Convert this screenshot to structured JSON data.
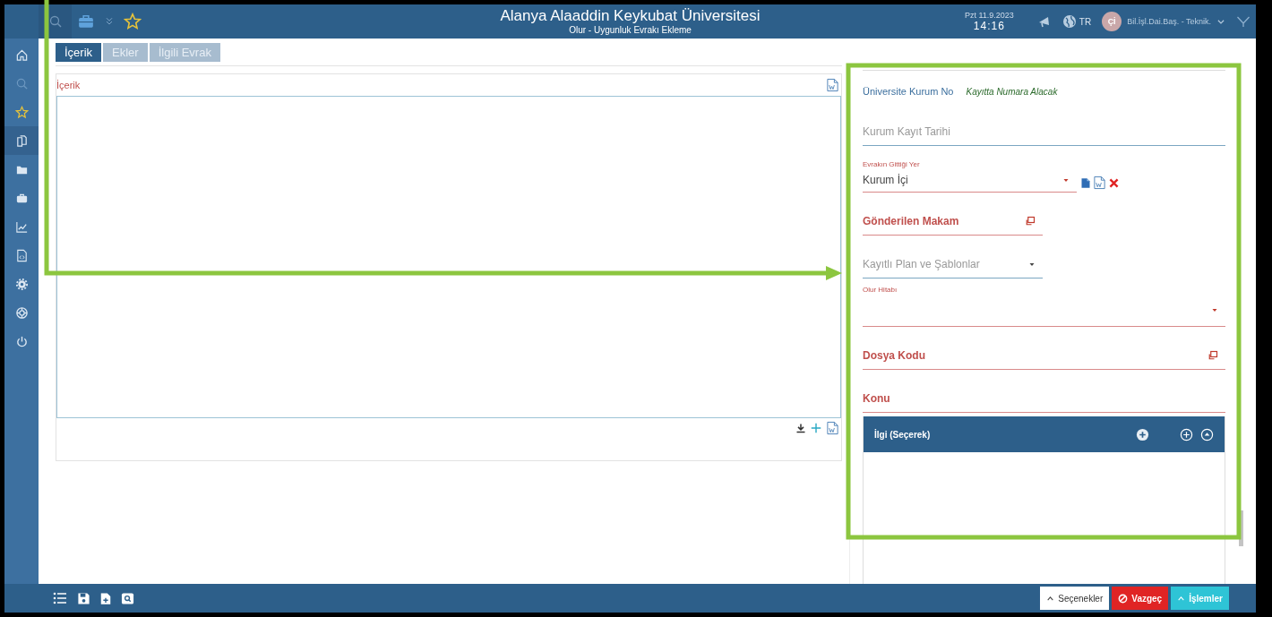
{
  "header": {
    "title": "Alanya Alaaddin Keykubat Üniversitesi",
    "subtitle": "Olur - Uygunluk Evrakı Ekleme",
    "date": "Pzt 11.9.2023",
    "time": "14:16",
    "language": "TR",
    "avatar": "Çİ",
    "user": "Bil.İşl.Dai.Baş. - Teknik."
  },
  "sidebar": [
    {
      "kind": "home",
      "selected": false
    },
    {
      "kind": "search",
      "selected": false
    },
    {
      "kind": "star",
      "selected": false
    },
    {
      "kind": "documents",
      "selected": true
    },
    {
      "kind": "folder",
      "selected": false
    },
    {
      "kind": "briefcase",
      "selected": false
    },
    {
      "kind": "chart",
      "selected": false
    },
    {
      "kind": "code-file",
      "selected": false
    },
    {
      "kind": "gear",
      "selected": false
    },
    {
      "kind": "lifebuoy",
      "selected": false
    },
    {
      "kind": "power",
      "selected": false
    }
  ],
  "tabs": [
    {
      "label": "İçerik",
      "selected": true
    },
    {
      "label": "Ekler",
      "selected": false
    },
    {
      "label": "İlgili Evrak",
      "selected": false
    }
  ],
  "editor": {
    "label": "İçerik"
  },
  "form": [
    {
      "kind": "info",
      "label": "Üniversite Kurum No",
      "value": "Kayıtta Numara Alacak"
    },
    {
      "kind": "input",
      "label": "Kurum Kayıt Tarihi",
      "required": false,
      "compact": false
    },
    {
      "kind": "select",
      "label": "Evrakın Gittiği Yer",
      "value": "Kurum İçi",
      "required": true,
      "compact": false,
      "actions": true
    },
    {
      "kind": "lookup",
      "label": "Gönderilen Makam",
      "required": true,
      "compact": true
    },
    {
      "kind": "dropdown",
      "label": "Kayıtlı Plan ve Şablonlar",
      "required": false,
      "compact": true
    },
    {
      "kind": "select",
      "label": "Olur Hitabı",
      "required": true,
      "compact": false,
      "actions": false
    },
    {
      "kind": "lookup",
      "label": "Dosya Kodu",
      "required": true,
      "compact": false
    },
    {
      "kind": "input",
      "label": "Konu",
      "required": true,
      "compact": false
    }
  ],
  "related": {
    "title": "İlgi (Seçerek)"
  },
  "footer": {
    "buttons": [
      {
        "kind": "default",
        "label": "Seçenekler"
      },
      {
        "kind": "danger",
        "label": "Vazgeç"
      },
      {
        "kind": "primary",
        "label": "İşlemler"
      }
    ]
  }
}
